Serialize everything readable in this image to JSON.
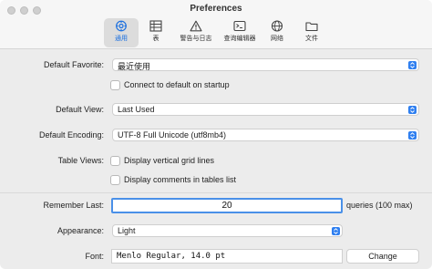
{
  "window": {
    "title": "Preferences"
  },
  "toolbar": {
    "items": [
      {
        "label": "通用",
        "icon": "gear-icon",
        "selected": true
      },
      {
        "label": "表",
        "icon": "table-icon",
        "selected": false
      },
      {
        "label": "警告与日志",
        "icon": "warning-icon",
        "selected": false
      },
      {
        "label": "查询编辑器",
        "icon": "terminal-icon",
        "selected": false
      },
      {
        "label": "网络",
        "icon": "globe-icon",
        "selected": false
      },
      {
        "label": "文件",
        "icon": "folder-icon",
        "selected": false
      }
    ]
  },
  "general": {
    "default_favorite": {
      "label": "Default Favorite:",
      "value": "最近使用"
    },
    "connect_on_startup": {
      "label": "Connect to default on startup",
      "checked": false
    },
    "default_view": {
      "label": "Default View:",
      "value": "Last Used"
    },
    "default_encoding": {
      "label": "Default Encoding:",
      "value": "UTF-8 Full Unicode (utf8mb4)"
    },
    "table_views": {
      "label": "Table Views:",
      "vertical_grid": {
        "label": "Display vertical grid lines",
        "checked": false
      },
      "comments": {
        "label": "Display comments in tables list",
        "checked": false
      }
    },
    "remember_last": {
      "label": "Remember Last:",
      "value": "20",
      "suffix": "queries (100 max)"
    },
    "appearance": {
      "label": "Appearance:",
      "value": "Light"
    },
    "font": {
      "label": "Font:",
      "value": "Menlo Regular, 14.0 pt",
      "button": "Change"
    }
  },
  "colors": {
    "accent": "#2f7ff0",
    "focus_ring": "#4a90e8",
    "selected_tab_text": "#1a6fe0"
  }
}
